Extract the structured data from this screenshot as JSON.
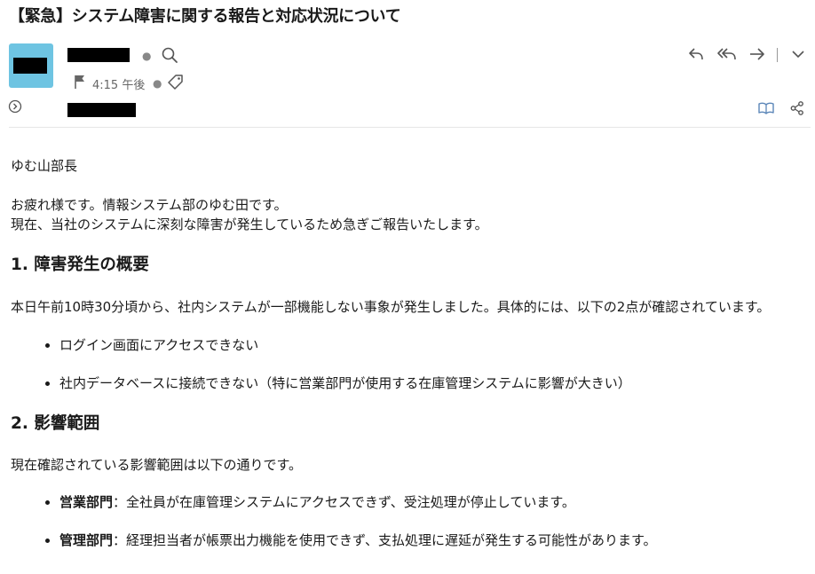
{
  "email": {
    "subject": "【緊急】システム障害に関する報告と対応状況について",
    "time": "4:15 午後"
  },
  "icons": {
    "search": "search-icon",
    "flag": "flag-icon",
    "tag": "tag-icon",
    "reply": "reply-icon",
    "reply_all": "reply-all-icon",
    "forward": "forward-icon",
    "more": "chevron-down-icon",
    "expand": "chevron-right-circle-icon",
    "reader": "book-icon",
    "share": "share-icon"
  },
  "body": {
    "greeting": "ゆむ山部長",
    "intro_1": "お疲れ様です。情報システム部のゆむ田です。",
    "intro_2": "現在、当社のシステムに深刻な障害が発生しているため急ぎご報告いたします。",
    "section1_title": "1. 障害発生の概要",
    "section1_text": "本日午前10時30分頃から、社内システムが一部機能しない事象が発生しました。具体的には、以下の2点が確認されています。",
    "section1_items": [
      "ログイン画面にアクセスできない",
      "社内データベースに接続できない（特に営業部門が使用する在庫管理システムに影響が大きい）"
    ],
    "section2_title": "2. 影響範囲",
    "section2_text": "現在確認されている影響範囲は以下の通りです。",
    "section2_items": [
      {
        "dept": "営業部門",
        "text": "：全社員が在庫管理システムにアクセスできず、受注処理が停止しています。"
      },
      {
        "dept": "管理部門",
        "text": "：経理担当者が帳票出力機能を使用できず、支払処理に遅延が発生する可能性があります。"
      }
    ]
  },
  "colors": {
    "avatar": "#6ec4e2",
    "redaction": "#000000"
  }
}
